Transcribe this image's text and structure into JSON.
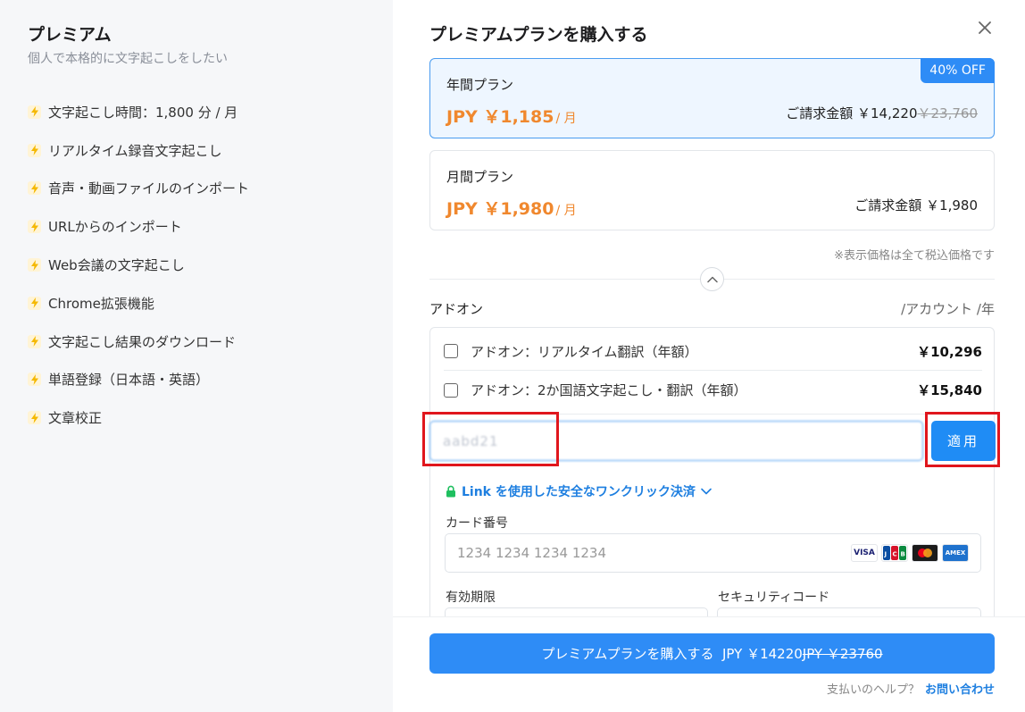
{
  "left": {
    "title": "プレミアム",
    "subtitle": "個人で本格的に文字起こしをしたい",
    "features": [
      "文字起こし時間：1,800 分 / 月",
      "リアルタイム録音文字起こし",
      "音声・動画ファイルのインポート",
      "URLからのインポート",
      "Web会議の文字起こし",
      "Chrome拡張機能",
      "文字起こし結果のダウンロード",
      "単語登録（日本語・英語）",
      "文章校正"
    ]
  },
  "main": {
    "title": "プレミアムプランを購入する",
    "plans": {
      "annual": {
        "name": "年間プラン",
        "price": "JPY ￥1,185",
        "unit": "/ 月",
        "bill_label": "ご請求金額 ￥14,220",
        "bill_original": "￥23,760",
        "badge": "40% OFF"
      },
      "monthly": {
        "name": "月間プラン",
        "price": "JPY ￥1,980",
        "unit": "/ 月",
        "bill_label": "ご請求金額 ￥1,980"
      }
    },
    "tax_note": "※表示価格は全て税込価格です",
    "addons": {
      "label": "アドオン",
      "unit": "/アカウント /年",
      "items": [
        {
          "label": "アドオン：リアルタイム翻訳（年額）",
          "price": "￥10,296"
        },
        {
          "label": "アドオン：2か国語文字起こし・翻訳（年額）",
          "price": "￥15,840"
        }
      ]
    },
    "coupon": {
      "value": "aabd21",
      "apply_label": "適用"
    },
    "link_pay": "Link を使用した安全なワンクリック決済",
    "card": {
      "number_label": "カード番号",
      "number_placeholder": "1234 1234 1234 1234",
      "brands": [
        "VISA",
        "JCB",
        "Mastercard",
        "AMEX"
      ],
      "expiry_label": "有効期限",
      "cvc_label": "セキュリティコード"
    },
    "footer": {
      "buy_label": "プレミアムプランを購入する",
      "buy_price": "JPY ￥14220",
      "buy_original": "JPY ￥23760",
      "help_text": "支払いのヘルプ？",
      "help_link": "お問い合わせ"
    }
  },
  "colors": {
    "accent": "#2e8cf6",
    "price_orange": "#f0882e",
    "highlight_red": "#e0161d"
  }
}
